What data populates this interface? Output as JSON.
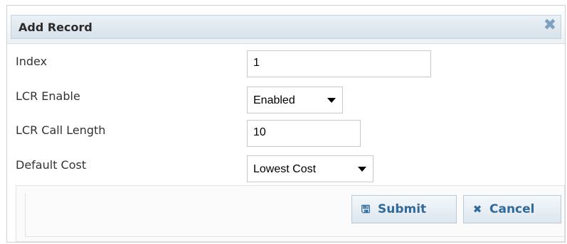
{
  "dialog": {
    "title": "Add Record",
    "close_icon_glyph": "✖"
  },
  "fields": {
    "index": {
      "label": "Index",
      "value": "1"
    },
    "lcr_enable": {
      "label": "LCR Enable",
      "value": "Enabled"
    },
    "lcr_call_length": {
      "label": "LCR Call Length",
      "value": "10"
    },
    "default_cost": {
      "label": "Default Cost",
      "value": "Lowest Cost"
    }
  },
  "buttons": {
    "submit": {
      "label": "Submit",
      "icon": "save-icon",
      "glyph": "🖫"
    },
    "cancel": {
      "label": "Cancel",
      "icon": "close-icon",
      "glyph": "✖"
    }
  },
  "colors": {
    "accent": "#2f6a9a",
    "title_bar": "#d8e2ea",
    "close_icon": "#7ea1c0"
  }
}
